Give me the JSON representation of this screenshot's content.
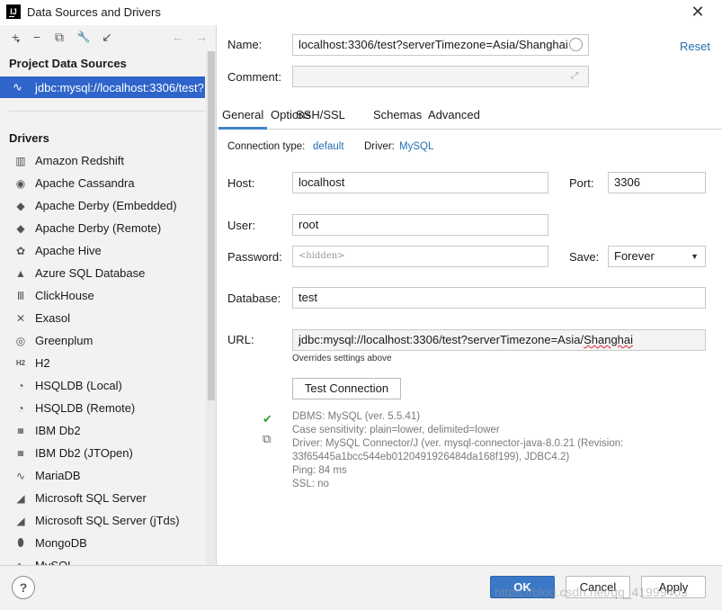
{
  "window": {
    "title": "Data Sources and Drivers",
    "app_icon": "IJ",
    "close_glyph": "✕"
  },
  "sidebar": {
    "toolbar": {
      "add": "+",
      "add_arrow": "▾",
      "remove": "−",
      "duplicate": "⧉",
      "settings": "🔧",
      "import": "↙",
      "back": "←",
      "forward": "→"
    },
    "project_title": "Project Data Sources",
    "selected_source": "jdbc:mysql://localhost:3306/test?",
    "drivers_title": "Drivers",
    "drivers": [
      {
        "label": "Amazon Redshift",
        "icon": "▥"
      },
      {
        "label": "Apache Cassandra",
        "icon": "◉"
      },
      {
        "label": "Apache Derby (Embedded)",
        "icon": "◆"
      },
      {
        "label": "Apache Derby (Remote)",
        "icon": "◆"
      },
      {
        "label": "Apache Hive",
        "icon": "✿"
      },
      {
        "label": "Azure SQL Database",
        "icon": "▲"
      },
      {
        "label": "ClickHouse",
        "icon": "Ⅲ"
      },
      {
        "label": "Exasol",
        "icon": "✕"
      },
      {
        "label": "Greenplum",
        "icon": "◎"
      },
      {
        "label": "H2",
        "icon": "H2"
      },
      {
        "label": "HSQLDB (Local)",
        "icon": "◔"
      },
      {
        "label": "HSQLDB (Remote)",
        "icon": "◔"
      },
      {
        "label": "IBM Db2",
        "icon": "▦"
      },
      {
        "label": "IBM Db2 (JTOpen)",
        "icon": "▦"
      },
      {
        "label": "MariaDB",
        "icon": "∿"
      },
      {
        "label": "Microsoft SQL Server",
        "icon": "◢"
      },
      {
        "label": "Microsoft SQL Server (jTds)",
        "icon": "◢"
      },
      {
        "label": "MongoDB",
        "icon": "⬮"
      },
      {
        "label": "MySQL",
        "icon": "∿"
      }
    ]
  },
  "form": {
    "name_label": "Name:",
    "name_value": "localhost:3306/test?serverTimezone=Asia/Shanghai",
    "reset_label": "Reset",
    "comment_label": "Comment:",
    "comment_value": "",
    "tabs": [
      "General",
      "Options",
      "SSH/SSL",
      "Schemas",
      "Advanced"
    ],
    "connection_type_label": "Connection type:",
    "connection_type_value": "default",
    "driver_label": "Driver:",
    "driver_value": "MySQL",
    "host_label": "Host:",
    "host_value": "localhost",
    "port_label": "Port:",
    "port_value": "3306",
    "user_label": "User:",
    "user_value": "root",
    "password_label": "Password:",
    "password_value": "<hidden>",
    "save_label": "Save:",
    "save_value": "Forever",
    "database_label": "Database:",
    "database_value": "test",
    "url_label": "URL:",
    "url_prefix": "jdbc:mysql://localhost:3306/test?serverTimezone=Asia/",
    "url_suffix": "Shanghai",
    "url_hint": "Overrides settings above",
    "test_button": "Test Connection"
  },
  "result": {
    "lines": [
      "DBMS: MySQL (ver. 5.5.41)",
      "Case sensitivity: plain=lower, delimited=lower",
      "Driver: MySQL Connector/J (ver. mysql-connector-java-8.0.21 (Revision:",
      "33f65445a1bcc544eb0120491926484da168f199), JDBC4.2)",
      "Ping: 84 ms",
      "SSL: no"
    ],
    "status_color": "#3a9d3a"
  },
  "footer": {
    "help": "?",
    "ok": "OK",
    "cancel": "Cancel",
    "apply": "Apply",
    "watermark": "https://blog.csdn.net/qq_41999403"
  },
  "colors": {
    "selection": "#2f65ca",
    "link": "#2470b3",
    "primary_button": "#3b78c7"
  }
}
